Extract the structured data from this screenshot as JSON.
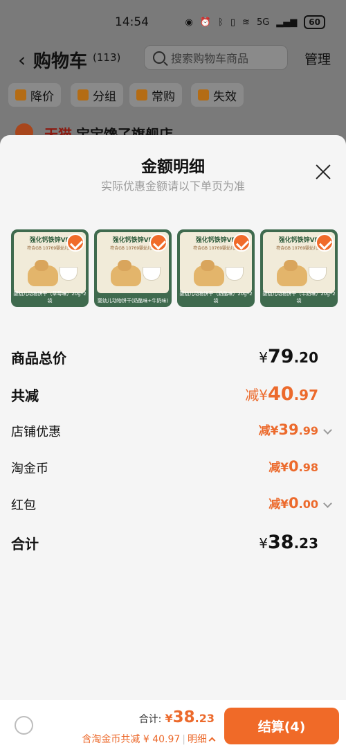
{
  "status_bar": {
    "time": "14:54",
    "battery": "60",
    "network": "5G"
  },
  "cart": {
    "title": "购物车",
    "count": "(113)",
    "search_placeholder": "搜索购物车商品",
    "manage_label": "管理",
    "filters": [
      "降价",
      "分组",
      "常购",
      "失效"
    ],
    "store_tag": "天猫",
    "store_name": "宝宝馋了旗舰店"
  },
  "sheet": {
    "title": "金额明细",
    "subtitle": "实际优惠金额请以下单页为准",
    "products": [
      {
        "header": "强化钙铁锌VB",
        "sub": "符合GB 10769婴幼儿...",
        "name": "婴幼儿动物饼干（草莓味）20g*2袋"
      },
      {
        "header": "强化钙铁锌VB",
        "sub": "符合GB 10769婴幼儿...",
        "name": "婴幼儿动物饼干(奶酪味+牛奶味)"
      },
      {
        "header": "强化钙铁锌VB",
        "sub": "符合GB 10769婴幼儿...",
        "name": "婴幼儿动物饼干（奶酪味）20g*2袋"
      },
      {
        "header": "强化钙铁锌VB",
        "sub": "符合GB 10769婴幼儿...",
        "name": "婴幼儿动物饼干（牛奶味）20g*2袋"
      }
    ],
    "rows": {
      "total_price": {
        "label": "商品总价",
        "currency": "¥",
        "int": "79",
        "dec": ".20"
      },
      "total_reduction": {
        "label": "共减",
        "prefix": "减¥",
        "int": "40",
        "dec": ".97"
      },
      "store_discount": {
        "label": "店铺优惠",
        "prefix": "减¥",
        "int": "39",
        "dec": ".99"
      },
      "taojinbi": {
        "label": "淘金币",
        "prefix": "减¥",
        "int": "0",
        "dec": ".98"
      },
      "red_packet": {
        "label": "红包",
        "prefix": "减¥",
        "int": "0",
        "dec": ".00"
      },
      "sum": {
        "label": "合计",
        "currency": "¥",
        "int": "38",
        "dec": ".23"
      }
    }
  },
  "bottom": {
    "total_label": "合计:",
    "currency": "¥",
    "int": "38",
    "dec": ".23",
    "discount_text": "含淘金币共减 ¥ 40.97",
    "detail_label": "明细",
    "checkout_label": "结算(4)"
  },
  "colors": {
    "accent": "#f06a28",
    "price_orange": "#ec6a2c",
    "product_bg": "#3f6a4e"
  }
}
